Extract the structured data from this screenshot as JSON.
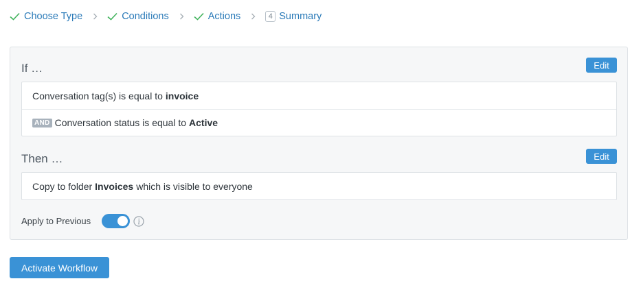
{
  "stepper": {
    "steps": [
      {
        "label": "Choose Type",
        "state": "done"
      },
      {
        "label": "Conditions",
        "state": "done"
      },
      {
        "label": "Actions",
        "state": "done"
      },
      {
        "number": "4",
        "label": "Summary",
        "state": "current"
      }
    ],
    "colors": {
      "check": "#41b35c",
      "link": "#2a7ab8"
    }
  },
  "if_section": {
    "title": "If …",
    "edit_label": "Edit",
    "conditions": [
      {
        "prefix": "",
        "text": "Conversation tag(s) is equal to",
        "value": "invoice"
      },
      {
        "prefix": "AND",
        "text": "Conversation status is equal to",
        "value": "Active"
      }
    ]
  },
  "then_section": {
    "title": "Then …",
    "edit_label": "Edit",
    "actions": [
      {
        "text": "Copy to folder",
        "value": "Invoices",
        "suffix": "which is visible to everyone"
      }
    ]
  },
  "apply_previous": {
    "label": "Apply to Previous",
    "enabled": true
  },
  "activate_label": "Activate Workflow",
  "accent_color": "#3a92d6"
}
